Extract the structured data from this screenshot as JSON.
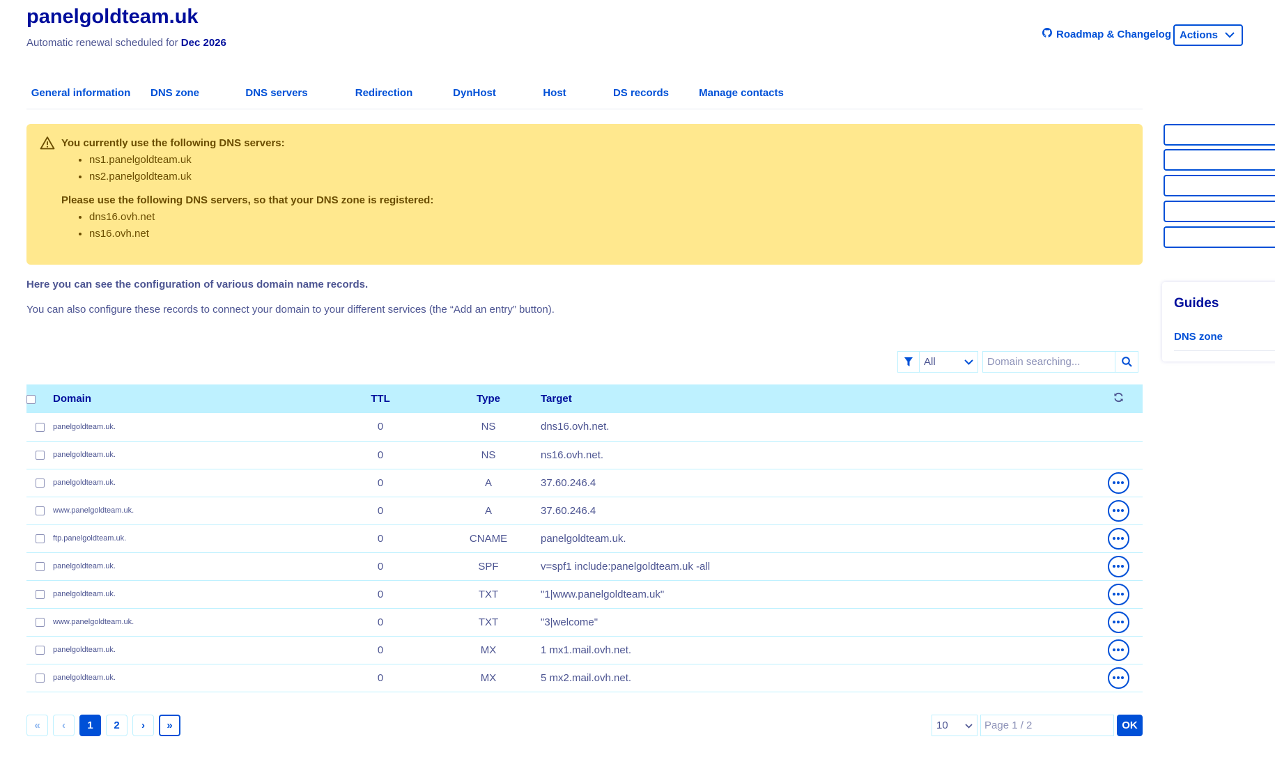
{
  "header": {
    "title": "panelgoldteam.uk",
    "subtitle_prefix": "Automatic renewal scheduled for",
    "renewal_date": "Dec 2026",
    "roadmap_label": "Roadmap & Changelog",
    "actions_label": "Actions"
  },
  "tabs": [
    {
      "label": "General information",
      "active": false
    },
    {
      "label": "DNS zone",
      "active": true
    },
    {
      "label": "DNS servers",
      "active": false
    },
    {
      "label": "Redirection",
      "active": false
    },
    {
      "label": "DynHost",
      "active": false
    },
    {
      "label": "Host",
      "active": false
    },
    {
      "label": "DS records",
      "active": false
    },
    {
      "label": "Manage contacts",
      "active": false
    }
  ],
  "alert": {
    "current_title": "You currently use the following DNS servers:",
    "current_servers": [
      "ns1.panelgoldteam.uk",
      "ns2.panelgoldteam.uk"
    ],
    "required_title": "Please use the following DNS servers, so that your DNS zone is registered:",
    "required_servers": [
      "dns16.ovh.net",
      "ns16.ovh.net"
    ]
  },
  "intro": {
    "bold": "Here you can see the configuration of various domain name records.",
    "text": "You can also configure these records to connect your domain to your different services (the “Add an entry” button)."
  },
  "filter": {
    "selected": "All",
    "search_placeholder": "Domain searching..."
  },
  "table": {
    "columns": {
      "domain": "Domain",
      "ttl": "TTL",
      "type": "Type",
      "target": "Target"
    },
    "rows": [
      {
        "domain": "panelgoldteam.uk.",
        "ttl": "0",
        "type": "NS",
        "target": "dns16.ovh.net.",
        "has_actions": false
      },
      {
        "domain": "panelgoldteam.uk.",
        "ttl": "0",
        "type": "NS",
        "target": "ns16.ovh.net.",
        "has_actions": false
      },
      {
        "domain": "panelgoldteam.uk.",
        "ttl": "0",
        "type": "A",
        "target": "37.60.246.4",
        "has_actions": true
      },
      {
        "domain": "www.panelgoldteam.uk.",
        "ttl": "0",
        "type": "A",
        "target": "37.60.246.4",
        "has_actions": true
      },
      {
        "domain": "ftp.panelgoldteam.uk.",
        "ttl": "0",
        "type": "CNAME",
        "target": "panelgoldteam.uk.",
        "has_actions": true
      },
      {
        "domain": "panelgoldteam.uk.",
        "ttl": "0",
        "type": "SPF",
        "target": "v=spf1 include:panelgoldteam.uk -all",
        "has_actions": true
      },
      {
        "domain": "panelgoldteam.uk.",
        "ttl": "0",
        "type": "TXT",
        "target": "\"1|www.panelgoldteam.uk\"",
        "has_actions": true
      },
      {
        "domain": "www.panelgoldteam.uk.",
        "ttl": "0",
        "type": "TXT",
        "target": "\"3|welcome\"",
        "has_actions": true
      },
      {
        "domain": "panelgoldteam.uk.",
        "ttl": "0",
        "type": "MX",
        "target": "1 mx1.mail.ovh.net.",
        "has_actions": true
      },
      {
        "domain": "panelgoldteam.uk.",
        "ttl": "0",
        "type": "MX",
        "target": "5 mx2.mail.ovh.net.",
        "has_actions": true
      }
    ]
  },
  "pagination": {
    "first_symbol": "«",
    "prev_symbol": "‹",
    "pages": [
      "1",
      "2"
    ],
    "current_page": "1",
    "next_symbol": "›",
    "last_symbol": "»",
    "page_size": "10",
    "page_placeholder": "Page 1 / 2",
    "ok_label": "OK"
  },
  "guides": {
    "title": "Guides",
    "link": "DNS zone"
  },
  "colors": {
    "primary": "#0050d7",
    "heading": "#000e9c",
    "text": "#4d5592",
    "alert_bg": "#ffe88e",
    "table_header_bg": "#bef1ff"
  }
}
